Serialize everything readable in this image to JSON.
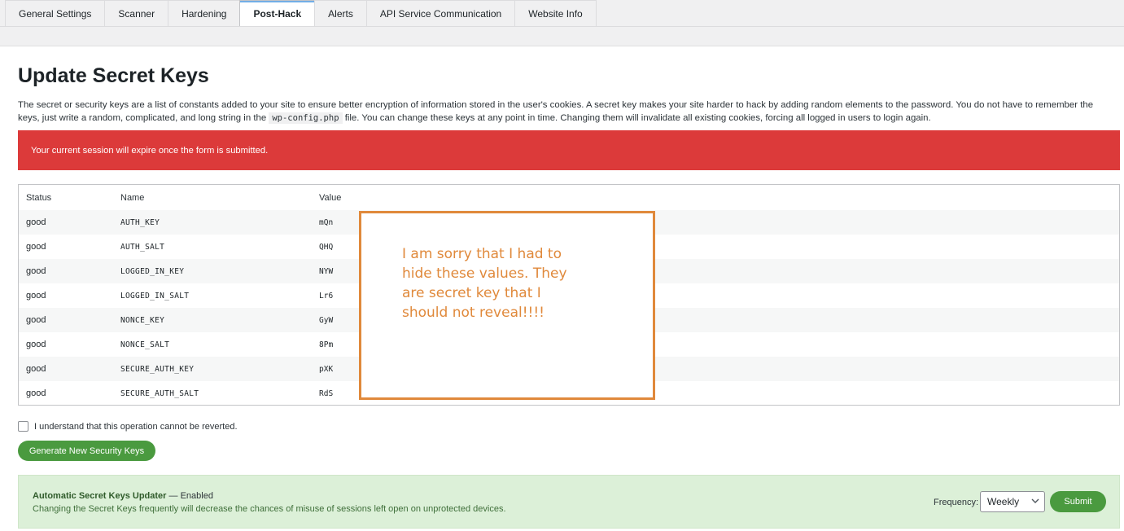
{
  "tabs": [
    {
      "label": "General Settings"
    },
    {
      "label": "Scanner"
    },
    {
      "label": "Hardening"
    },
    {
      "label": "Post-Hack"
    },
    {
      "label": "Alerts"
    },
    {
      "label": "API Service Communication"
    },
    {
      "label": "Website Info"
    }
  ],
  "page": {
    "title": "Update Secret Keys",
    "desc_part1": "The secret or security keys are a list of constants added to your site to ensure better encryption of information stored in the user's cookies. A secret key makes your site harder to hack by adding random elements to the password. You do not have to remember the keys, just write a random, complicated, and long string in the",
    "desc_code": "wp-config.php",
    "desc_part2": "file. You can change these keys at any point in time. Changing them will invalidate all existing cookies, forcing all logged in users to login again.",
    "alert": "Your current session will expire once the form is submitted."
  },
  "table": {
    "headers": {
      "status": "Status",
      "name": "Name",
      "value": "Value"
    },
    "rows": [
      {
        "status": "good",
        "name": "AUTH_KEY",
        "value": "mQn"
      },
      {
        "status": "good",
        "name": "AUTH_SALT",
        "value": "QHQ"
      },
      {
        "status": "good",
        "name": "LOGGED_IN_KEY",
        "value": "NYW"
      },
      {
        "status": "good",
        "name": "LOGGED_IN_SALT",
        "value": "Lr6"
      },
      {
        "status": "good",
        "name": "NONCE_KEY",
        "value": "GyW"
      },
      {
        "status": "good",
        "name": "NONCE_SALT",
        "value": "8Pm"
      },
      {
        "status": "good",
        "name": "SECURE_AUTH_KEY",
        "value": "pXK"
      },
      {
        "status": "good",
        "name": "SECURE_AUTH_SALT",
        "value": "RdS"
      }
    ]
  },
  "overlay": {
    "note": "I am sorry that I had to hide these values. They are secret key that I should not reveal!!!!"
  },
  "confirm": {
    "label": "I understand that this operation cannot be reverted."
  },
  "generate_button": "Generate New Security Keys",
  "updater": {
    "title": "Automatic Secret Keys Updater",
    "status": "— Enabled",
    "description": "Changing the Secret Keys frequently will decrease the chances of misuse of sessions left open on unprotected devices.",
    "frequency_label": "Frequency:",
    "frequency_value": "Weekly",
    "submit_label": "Submit"
  },
  "colors": {
    "alert_bg": "#dc3a3a",
    "button_green": "#4a9a3f",
    "updater_bg": "#dcf0d8",
    "overlay_orange": "#e0893b",
    "active_tab_accent": "#72aee6"
  }
}
